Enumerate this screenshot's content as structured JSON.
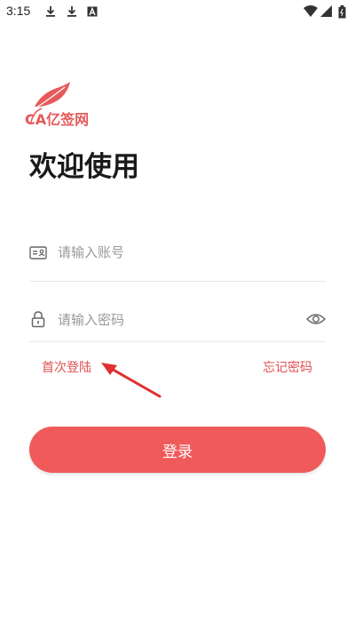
{
  "status_bar": {
    "time": "3:15",
    "icons": [
      "download-icon",
      "download-icon",
      "a-square-icon",
      "wifi-icon",
      "signal-icon",
      "battery-icon"
    ]
  },
  "logo": {
    "text": "CA亿签网"
  },
  "welcome_title": "欢迎使用",
  "account": {
    "placeholder": "请输入账号",
    "value": "",
    "icon": "id-card-icon"
  },
  "password": {
    "placeholder": "请输入密码",
    "value": "",
    "icon": "lock-icon",
    "toggle_icon": "eye-icon"
  },
  "links": {
    "first_login": "首次登陆",
    "forgot_password": "忘记密码"
  },
  "login_button": "登录",
  "colors": {
    "accent": "#f05a5a",
    "link": "#e0504f",
    "arrow": "#e03030"
  }
}
